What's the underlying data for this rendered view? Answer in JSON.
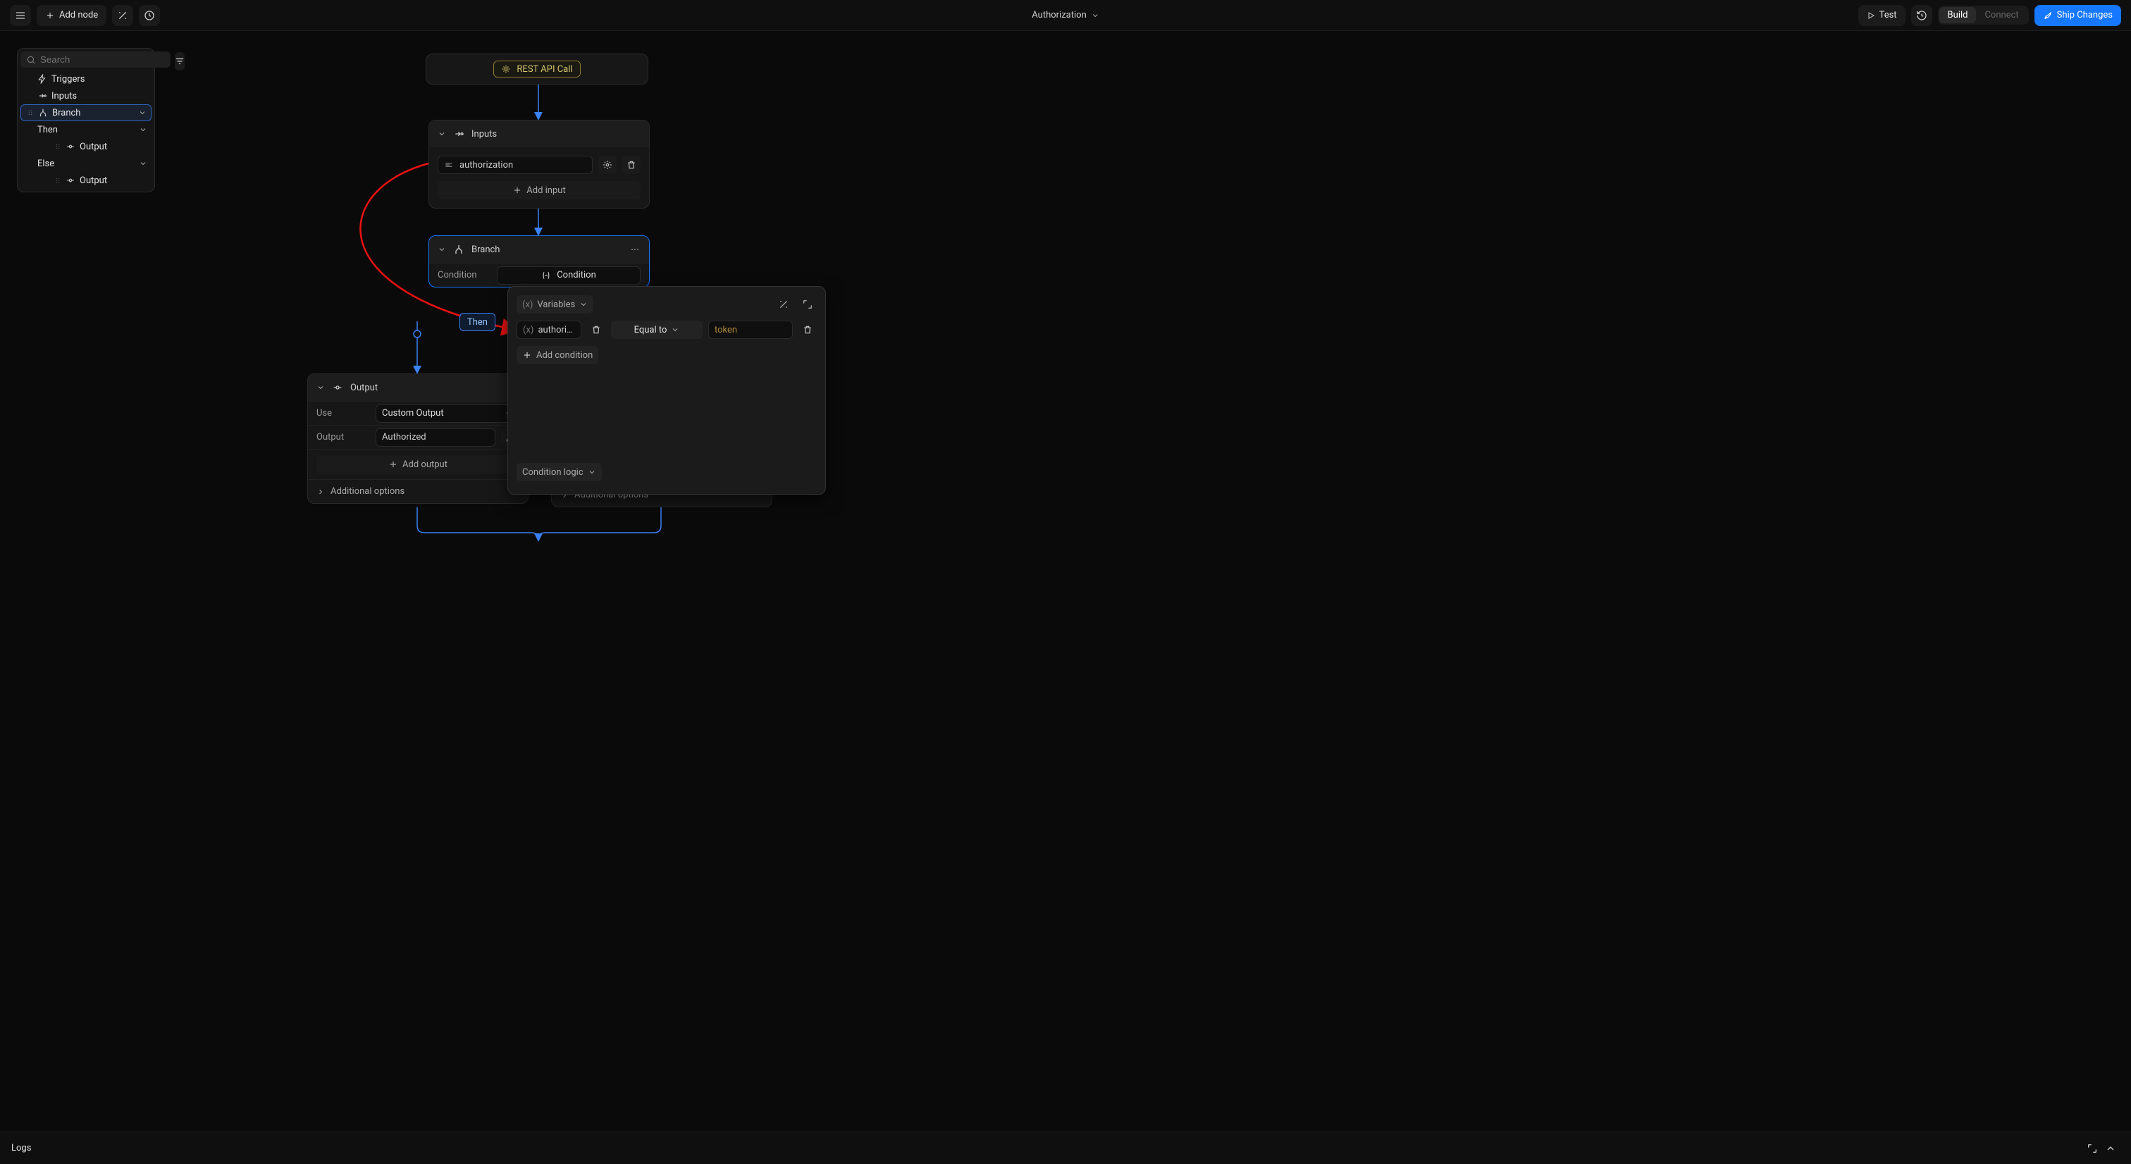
{
  "topbar": {
    "add_node": "Add node",
    "title": "Authorization",
    "test": "Test",
    "seg_build": "Build",
    "seg_connect": "Connect",
    "ship": "Ship Changes"
  },
  "sidebar": {
    "search_placeholder": "Search",
    "triggers": "Triggers",
    "inputs": "Inputs",
    "branch": "Branch",
    "then": "Then",
    "output1": "Output",
    "else": "Else",
    "output2": "Output"
  },
  "nodes": {
    "trigger_pill": "REST API Call",
    "inputs": {
      "title": "Inputs",
      "field_value": "authorization",
      "add_input": "Add input"
    },
    "branch": {
      "title": "Branch",
      "condition_label": "Condition",
      "condition_btn": "Condition",
      "then_chip": "Then"
    },
    "output": {
      "title": "Output",
      "use_label": "Use",
      "use_value": "Custom Output",
      "output_label": "Output",
      "output_value": "Authorized",
      "add_output": "Add output",
      "additional": "Additional options"
    },
    "output_right": {
      "additional": "Additional options"
    }
  },
  "popover": {
    "variables": "Variables",
    "var_chip": "authoriz…",
    "operator": "Equal to",
    "value": "token",
    "add_condition": "Add condition",
    "logic": "Condition logic"
  },
  "logs": {
    "label": "Logs"
  }
}
